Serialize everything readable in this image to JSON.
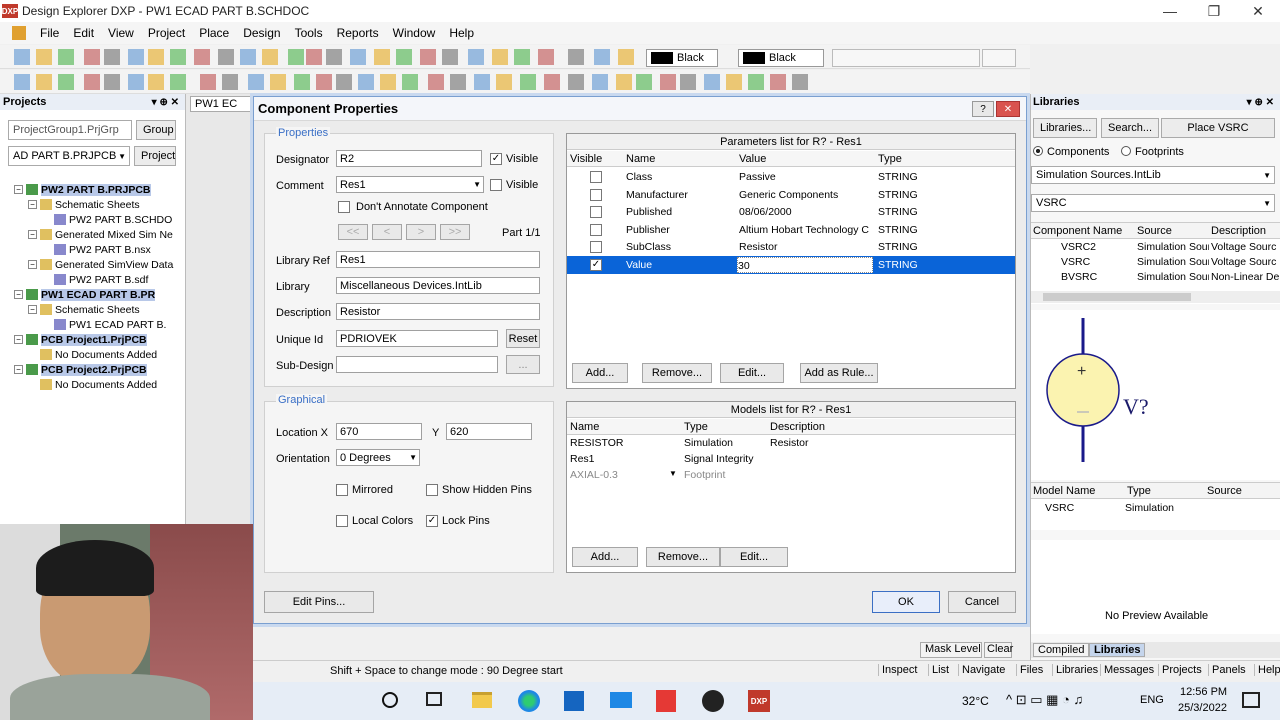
{
  "window": {
    "title": "Design Explorer DXP - PW1 ECAD PART B.SCHDOC",
    "min": "—",
    "max": "❐",
    "close": "✕"
  },
  "menu": [
    "File",
    "Edit",
    "View",
    "Project",
    "Place",
    "Design",
    "Tools",
    "Reports",
    "Window",
    "Help"
  ],
  "toolbar": {
    "color1": "Black",
    "color2": "Black"
  },
  "projects": {
    "title": "Projects",
    "workspace": "ProjectGroup1.PrjGrp",
    "group_btn": "Group",
    "project_sel": "AD PART B.PRJPCB",
    "project_btn": "Project",
    "tree": [
      {
        "t": "PW2 PART B.PRJPCB",
        "lvl": 0,
        "sel": true,
        "ex": "−"
      },
      {
        "t": "Schematic Sheets",
        "lvl": 1,
        "ex": "−"
      },
      {
        "t": "PW2 PART B.SCHDO",
        "lvl": 2
      },
      {
        "t": "Generated Mixed Sim Ne",
        "lvl": 1,
        "ex": "−"
      },
      {
        "t": "PW2 PART B.nsx",
        "lvl": 2
      },
      {
        "t": "Generated SimView Data",
        "lvl": 1,
        "ex": "−"
      },
      {
        "t": "PW2 PART B.sdf",
        "lvl": 2
      },
      {
        "t": "PW1 ECAD PART B.PR",
        "lvl": 0,
        "sel": true,
        "ex": "−"
      },
      {
        "t": "Schematic Sheets",
        "lvl": 1,
        "ex": "−"
      },
      {
        "t": "PW1 ECAD PART B.",
        "lvl": 2
      },
      {
        "t": "PCB Project1.PrjPCB",
        "lvl": 0,
        "sel": true,
        "ex": "−"
      },
      {
        "t": "No Documents Added",
        "lvl": 1
      },
      {
        "t": "PCB Project2.PrjPCB",
        "lvl": 0,
        "sel": true,
        "ex": "−"
      },
      {
        "t": "No Documents Added",
        "lvl": 1
      }
    ]
  },
  "doc_tab": "PW1 EC",
  "dialog": {
    "title": "Component Properties",
    "help": "?",
    "close": "✕",
    "properties": {
      "legend": "Properties",
      "designator_label": "Designator",
      "designator": "R2",
      "visible1": "Visible",
      "comment_label": "Comment",
      "comment": "Res1",
      "visible2": "Visible",
      "dont_annotate": "Don't Annotate Component",
      "nav": [
        "<<",
        "<",
        ">",
        ">>"
      ],
      "part": "Part 1/1",
      "libref_label": "Library Ref",
      "libref": "Res1",
      "library_label": "Library",
      "library": "Miscellaneous Devices.IntLib",
      "description_label": "Description",
      "description": "Resistor",
      "uniqueid_label": "Unique Id",
      "uniqueid": "PDRIOVEK",
      "reset": "Reset",
      "subdesign_label": "Sub-Design",
      "subdesign_btn": "..."
    },
    "graphical": {
      "legend": "Graphical",
      "location_label": "Location X",
      "x": "670",
      "y_label": "Y",
      "y": "620",
      "orientation_label": "Orientation",
      "orientation": "0 Degrees",
      "mirrored": "Mirrored",
      "show_hidden": "Show Hidden Pins",
      "local_colors": "Local Colors",
      "lock_pins": "Lock Pins"
    },
    "params": {
      "title": "Parameters list for R? - Res1",
      "headers": [
        "Visible",
        "Name",
        "Value",
        "Type"
      ],
      "rows": [
        {
          "vis": false,
          "name": "Class",
          "value": "Passive",
          "type": "STRING"
        },
        {
          "vis": false,
          "name": "Manufacturer",
          "value": "Generic Components",
          "type": "STRING"
        },
        {
          "vis": false,
          "name": "Published",
          "value": "08/06/2000",
          "type": "STRING"
        },
        {
          "vis": false,
          "name": "Publisher",
          "value": "Altium Hobart Technology Cen",
          "type": "STRING"
        },
        {
          "vis": false,
          "name": "SubClass",
          "value": "Resistor",
          "type": "STRING"
        },
        {
          "vis": true,
          "name": "Value",
          "value": "30",
          "type": "STRING",
          "sel": true
        }
      ],
      "buttons": [
        "Add...",
        "Remove...",
        "Edit...",
        "Add as Rule..."
      ]
    },
    "models": {
      "title": "Models list for R? - Res1",
      "headers": [
        "Name",
        "Type",
        "Description"
      ],
      "rows": [
        {
          "name": "RESISTOR",
          "type": "Simulation",
          "desc": "Resistor"
        },
        {
          "name": "Res1",
          "type": "Signal Integrity",
          "desc": ""
        },
        {
          "name": "AXIAL-0.3",
          "type": "Footprint",
          "desc": ""
        }
      ],
      "buttons": [
        "Add...",
        "Remove...",
        "Edit..."
      ]
    },
    "edit_pins": "Edit Pins...",
    "ok": "OK",
    "cancel": "Cancel"
  },
  "libraries": {
    "title": "Libraries",
    "btns": [
      "Libraries...",
      "Search...",
      "Place VSRC"
    ],
    "components": "Components",
    "footprints": "Footprints",
    "lib": "Simulation Sources.IntLib",
    "filter": "VSRC",
    "headers": [
      "Component Name",
      "Source",
      "Description"
    ],
    "rows": [
      {
        "name": "VSRC2",
        "src": "Simulation Sourc",
        "desc": "Voltage Sourc"
      },
      {
        "name": "VSRC",
        "src": "Simulation Sourc",
        "desc": "Voltage Sourc"
      },
      {
        "name": "BVSRC",
        "src": "Simulation Sourc",
        "desc": "Non-Linear De"
      }
    ],
    "symbol_label": "V?",
    "model_headers": [
      "Model Name",
      "Type",
      "Source"
    ],
    "model_row": {
      "name": "VSRC",
      "type": "Simulation"
    },
    "no_preview": "No Preview Available",
    "tabs": [
      "Compiled",
      "Libraries"
    ]
  },
  "status": {
    "text": "Shift + Space to change mode : 90 Degree start",
    "mask": "Mask Level",
    "clear": "Clear",
    "panels": [
      "Inspect",
      "List",
      "Navigate",
      "Files",
      "Libraries",
      "Messages",
      "Projects",
      "Panels",
      "Help"
    ]
  },
  "taskbar": {
    "temp": "32°C",
    "lang": "ENG",
    "time": "12:56 PM",
    "date": "25/3/2022"
  }
}
